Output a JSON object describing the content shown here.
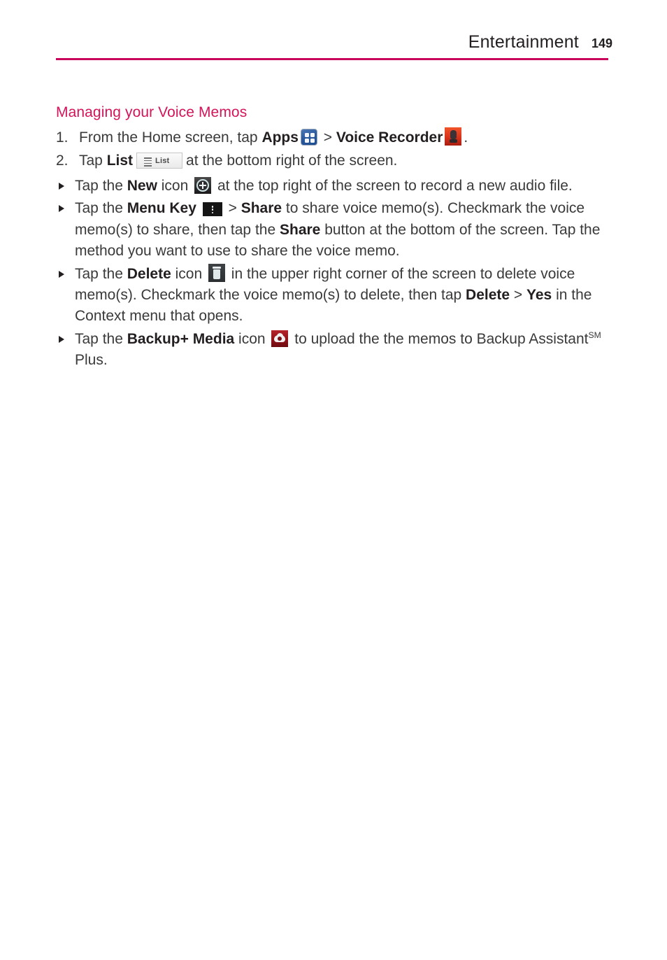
{
  "header": {
    "title": "Entertainment",
    "page_number": "149",
    "rule_color": "#c8005a"
  },
  "section": {
    "heading": "Managing your Voice Memos",
    "heading_color": "#d4145a"
  },
  "steps": [
    {
      "number": "1.",
      "text_before_bold1": "From the Home screen, tap ",
      "bold1": "Apps",
      "icon1": "apps-grid-icon",
      "text_mid": " > ",
      "bold2": "Voice Recorder",
      "icon2": "voice-recorder-icon",
      "text_after": "."
    },
    {
      "number": "2.",
      "text_before_bold1": "Tap ",
      "bold1": "List",
      "icon1": "list-button-icon",
      "icon1_label": "List",
      "text_after": "at the bottom right of the screen."
    }
  ],
  "bullets": [
    {
      "lead": "Tap the ",
      "bold1": "New",
      "mid1": " icon ",
      "icon": "new-plus-icon",
      "tail": " at the top right of the screen to record a new audio file."
    },
    {
      "lead": "Tap the ",
      "bold1": "Menu Key",
      "mid1": " ",
      "icon": "menu-key-icon",
      "mid2": " > ",
      "bold2": "Share",
      "mid3": " to share voice memo(s). Checkmark the voice memo(s) to share, then tap the ",
      "bold3": "Share",
      "tail": " button at the bottom of the screen. Tap the method you want to use to share the voice memo."
    },
    {
      "lead": "Tap the ",
      "bold1": "Delete",
      "mid1": " icon ",
      "icon": "delete-trash-icon",
      "mid2": " in the upper right corner of the screen to delete voice memo(s). Checkmark the voice memo(s) to delete, then tap ",
      "bold2": "Delete",
      "mid3": " > ",
      "bold3": "Yes",
      "tail": " in the Context menu that opens."
    },
    {
      "lead": "Tap the ",
      "bold1": "Backup+ Media",
      "mid1": " icon ",
      "icon": "backup-media-icon",
      "mid2": " to upload the the memos to Backup Assistant",
      "sup": "SM",
      "tail": " Plus."
    }
  ]
}
